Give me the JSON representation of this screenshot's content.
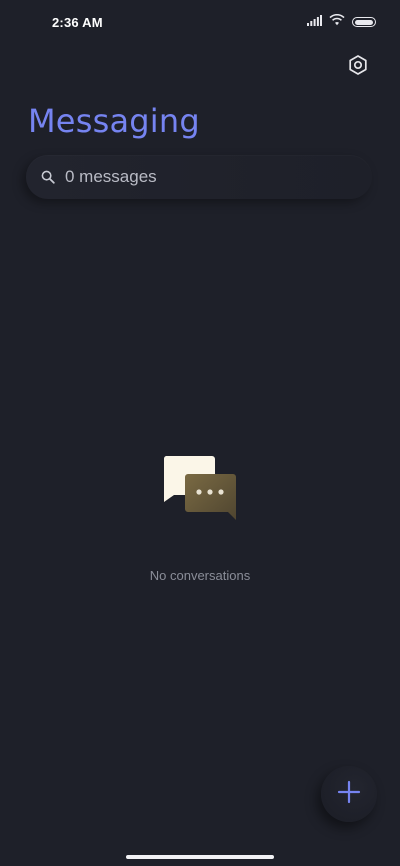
{
  "status_bar": {
    "time": "2:36 AM"
  },
  "header": {
    "title": "Messaging"
  },
  "search": {
    "placeholder": "0 messages"
  },
  "empty_state": {
    "text": "No conversations"
  },
  "icons": {
    "settings": "gear-icon",
    "search": "search-icon",
    "new_conversation": "plus-icon",
    "empty": "chat-bubbles-icon"
  },
  "colors": {
    "background": "#1e2029",
    "accent": "#7684f1",
    "muted_text": "#8a8d98"
  }
}
